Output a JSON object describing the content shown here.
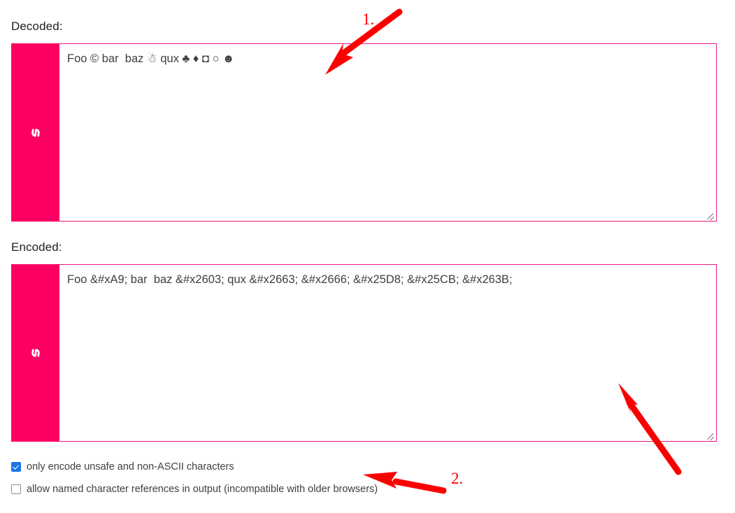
{
  "fields": [
    {
      "label": "Decoded:",
      "value": "Foo © bar  baz ☃ qux ♣ ♦ ◘ ○ ☻",
      "handle_icon": "link-icon"
    },
    {
      "label": "Encoded:",
      "value": "Foo &#xA9; bar  baz &#x2603; qux &#x2663; &#x2666; &#x25D8; &#x25CB; &#x263B;",
      "handle_icon": "link-icon"
    }
  ],
  "options": [
    {
      "label": "only encode unsafe and non-ASCII characters",
      "checked": true
    },
    {
      "label": "allow named character references in output (incompatible with older browsers)",
      "checked": false
    }
  ],
  "annotations": {
    "marker_1": "1.",
    "marker_2": "2."
  },
  "colors": {
    "handle_pink": "#fb0062",
    "border_pink": "#e5197f",
    "annotation_red": "#fb0000",
    "checkbox_blue": "#1a73e8",
    "text_gray": "#3c4043"
  }
}
